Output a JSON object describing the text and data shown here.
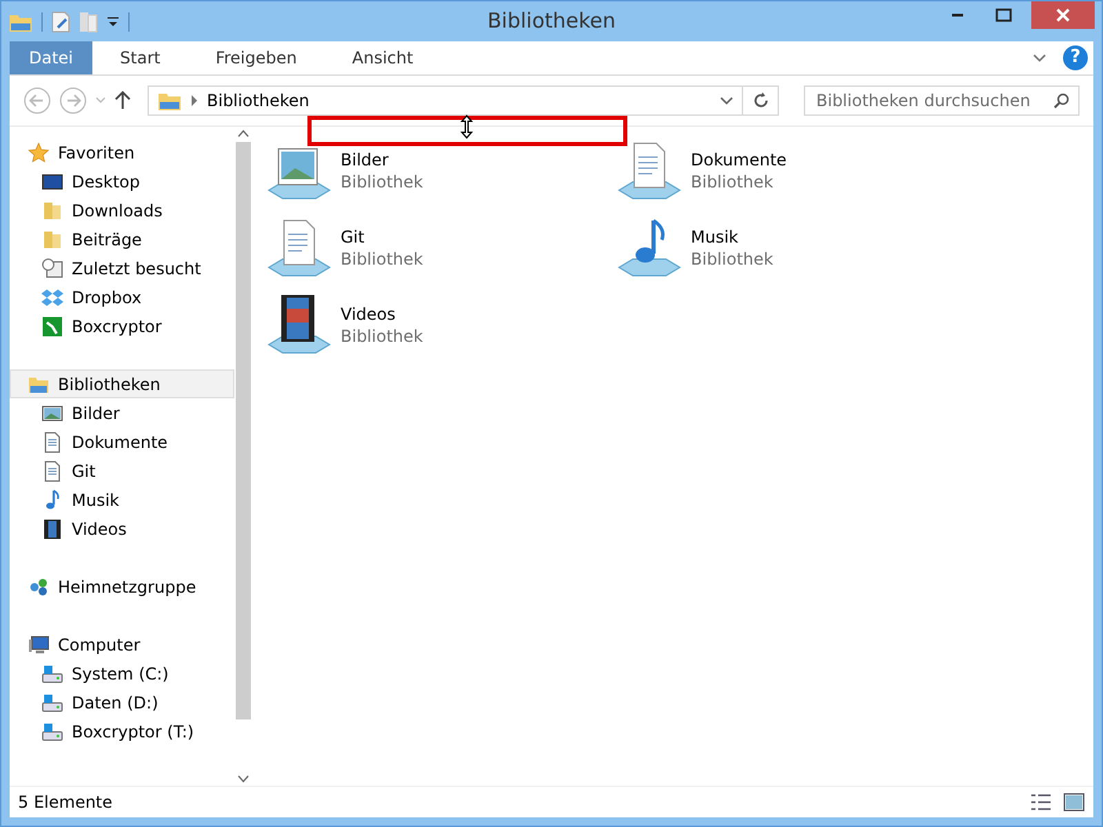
{
  "window": {
    "title": "Bibliotheken"
  },
  "ribbon": {
    "tabs": [
      {
        "label": "Datei",
        "kind": "file_menu"
      },
      {
        "label": "Start",
        "kind": "tab"
      },
      {
        "label": "Freigeben",
        "kind": "tab"
      },
      {
        "label": "Ansicht",
        "kind": "tab"
      }
    ],
    "help_button": {
      "label": "?"
    }
  },
  "address_bar": {
    "path": "Bibliotheken"
  },
  "search": {
    "placeholder": "Bibliotheken durchsuchen"
  },
  "navigation": [
    {
      "label": "Favoriten",
      "selected": false,
      "children": [
        {
          "label": "Desktop",
          "selected": false
        },
        {
          "label": "Downloads",
          "selected": false
        },
        {
          "label": "Beiträge",
          "selected": false
        },
        {
          "label": "Zuletzt besucht",
          "selected": false
        },
        {
          "label": "Dropbox",
          "selected": false
        },
        {
          "label": "Boxcryptor",
          "selected": false
        }
      ]
    },
    {
      "label": "Bibliotheken",
      "selected": true,
      "children": [
        {
          "label": "Bilder",
          "selected": false
        },
        {
          "label": "Dokumente",
          "selected": false
        },
        {
          "label": "Git",
          "selected": false
        },
        {
          "label": "Musik",
          "selected": false
        },
        {
          "label": "Videos",
          "selected": false
        }
      ]
    },
    {
      "label": "Heimnetzgruppe",
      "selected": false
    },
    {
      "label": "Computer",
      "selected": false,
      "children": [
        {
          "label": "System (C:)",
          "selected": false
        },
        {
          "label": "Daten (D:)",
          "selected": false
        },
        {
          "label": "Boxcryptor (T:)",
          "selected": false
        }
      ]
    }
  ],
  "libraries": [
    {
      "name": "Bilder",
      "type": "Bibliothek"
    },
    {
      "name": "Dokumente",
      "type": "Bibliothek"
    },
    {
      "name": "Git",
      "type": "Bibliothek"
    },
    {
      "name": "Musik",
      "type": "Bibliothek"
    },
    {
      "name": "Videos",
      "type": "Bibliothek"
    }
  ],
  "status_bar": {
    "count": "5 Elemente"
  }
}
